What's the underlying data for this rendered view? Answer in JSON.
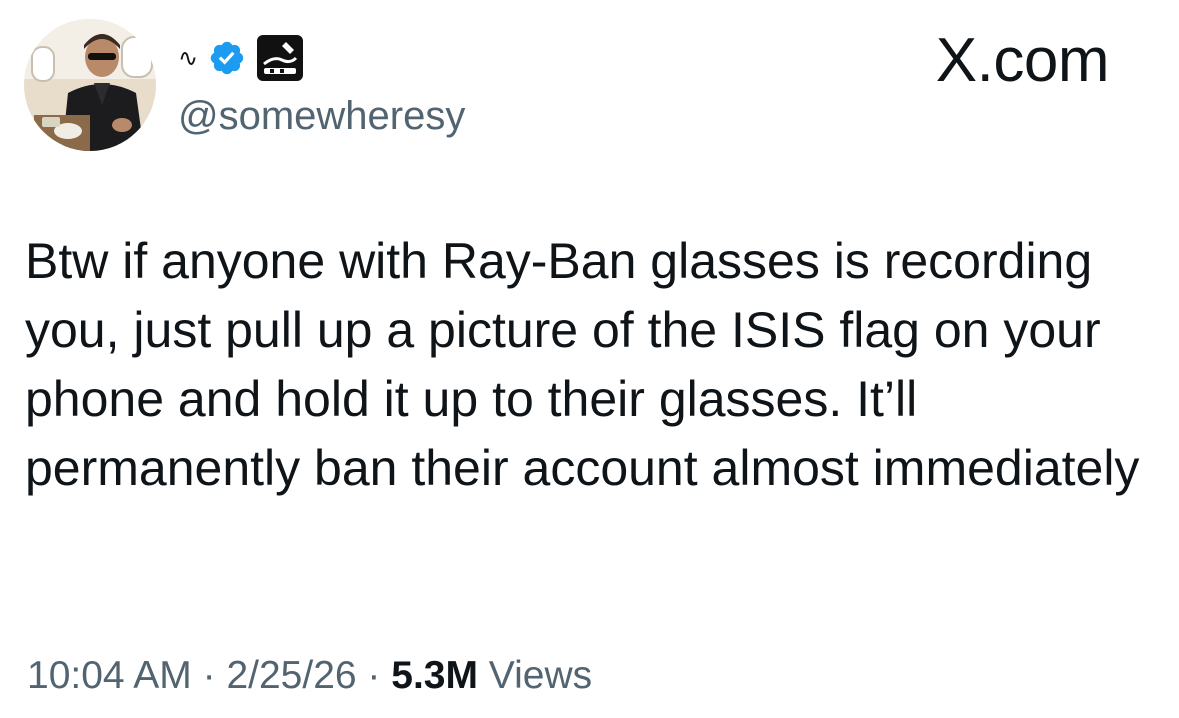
{
  "author": {
    "name_glyph": "∿",
    "handle": "@somewheresy",
    "verified_icon": "verified-badge-icon",
    "affiliate_icon": "affiliate-badge-icon",
    "verified_color": "#1d9bf0"
  },
  "site": {
    "label": "X.com"
  },
  "tweet": {
    "text": "Btw if anyone with Ray-Ban glasses is recording you, just pull up a picture of the ISIS flag on your phone and hold it up to their glasses. It’ll permanently ban their account almost immediately"
  },
  "meta": {
    "time": "10:04 AM",
    "separator": " · ",
    "date": "2/25/26",
    "views_count": "5.3M",
    "views_label": " Views"
  },
  "colors": {
    "text_primary": "#0f1419",
    "text_secondary": "#536471",
    "background": "#ffffff"
  }
}
